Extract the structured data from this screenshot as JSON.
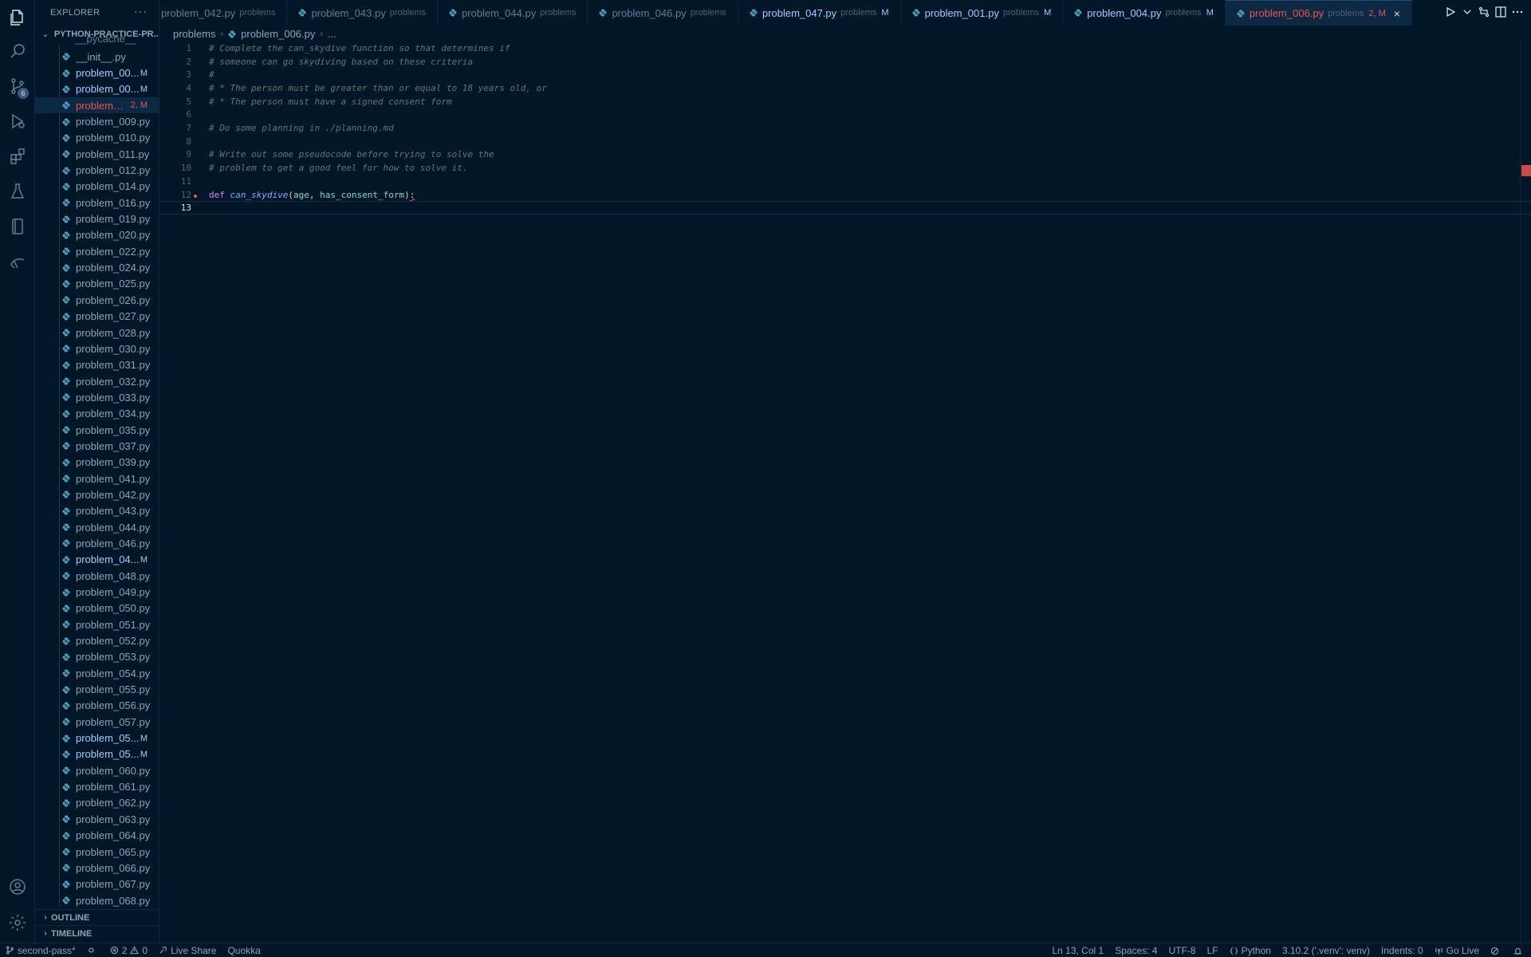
{
  "explorer": {
    "title": "EXPLORER",
    "more": "···",
    "folder": "PYTHON-PRACTICE-PR...",
    "partial_above": "__pycache__",
    "files": [
      {
        "label": "__init__.py",
        "badge": "",
        "state": "normal"
      },
      {
        "label": "problem_00...",
        "badge": "M",
        "state": "mod"
      },
      {
        "label": "problem_00...",
        "badge": "M",
        "state": "mod"
      },
      {
        "label": "problem_...",
        "badge": "2, M",
        "state": "err"
      },
      {
        "label": "problem_009.py",
        "badge": "",
        "state": "normal"
      },
      {
        "label": "problem_010.py",
        "badge": "",
        "state": "normal"
      },
      {
        "label": "problem_011.py",
        "badge": "",
        "state": "normal"
      },
      {
        "label": "problem_012.py",
        "badge": "",
        "state": "normal"
      },
      {
        "label": "problem_014.py",
        "badge": "",
        "state": "normal"
      },
      {
        "label": "problem_016.py",
        "badge": "",
        "state": "normal"
      },
      {
        "label": "problem_019.py",
        "badge": "",
        "state": "normal"
      },
      {
        "label": "problem_020.py",
        "badge": "",
        "state": "normal"
      },
      {
        "label": "problem_022.py",
        "badge": "",
        "state": "normal"
      },
      {
        "label": "problem_024.py",
        "badge": "",
        "state": "normal"
      },
      {
        "label": "problem_025.py",
        "badge": "",
        "state": "normal"
      },
      {
        "label": "problem_026.py",
        "badge": "",
        "state": "normal"
      },
      {
        "label": "problem_027.py",
        "badge": "",
        "state": "normal"
      },
      {
        "label": "problem_028.py",
        "badge": "",
        "state": "normal"
      },
      {
        "label": "problem_030.py",
        "badge": "",
        "state": "normal"
      },
      {
        "label": "problem_031.py",
        "badge": "",
        "state": "normal"
      },
      {
        "label": "problem_032.py",
        "badge": "",
        "state": "normal"
      },
      {
        "label": "problem_033.py",
        "badge": "",
        "state": "normal"
      },
      {
        "label": "problem_034.py",
        "badge": "",
        "state": "normal"
      },
      {
        "label": "problem_035.py",
        "badge": "",
        "state": "normal"
      },
      {
        "label": "problem_037.py",
        "badge": "",
        "state": "normal"
      },
      {
        "label": "problem_039.py",
        "badge": "",
        "state": "normal"
      },
      {
        "label": "problem_041.py",
        "badge": "",
        "state": "normal"
      },
      {
        "label": "problem_042.py",
        "badge": "",
        "state": "normal"
      },
      {
        "label": "problem_043.py",
        "badge": "",
        "state": "normal"
      },
      {
        "label": "problem_044.py",
        "badge": "",
        "state": "normal"
      },
      {
        "label": "problem_046.py",
        "badge": "",
        "state": "normal"
      },
      {
        "label": "problem_04...",
        "badge": "M",
        "state": "mod"
      },
      {
        "label": "problem_048.py",
        "badge": "",
        "state": "normal"
      },
      {
        "label": "problem_049.py",
        "badge": "",
        "state": "normal"
      },
      {
        "label": "problem_050.py",
        "badge": "",
        "state": "normal"
      },
      {
        "label": "problem_051.py",
        "badge": "",
        "state": "normal"
      },
      {
        "label": "problem_052.py",
        "badge": "",
        "state": "normal"
      },
      {
        "label": "problem_053.py",
        "badge": "",
        "state": "normal"
      },
      {
        "label": "problem_054.py",
        "badge": "",
        "state": "normal"
      },
      {
        "label": "problem_055.py",
        "badge": "",
        "state": "normal"
      },
      {
        "label": "problem_056.py",
        "badge": "",
        "state": "normal"
      },
      {
        "label": "problem_057.py",
        "badge": "",
        "state": "normal"
      },
      {
        "label": "problem_05...",
        "badge": "M",
        "state": "mod"
      },
      {
        "label": "problem_05...",
        "badge": "M",
        "state": "mod"
      },
      {
        "label": "problem_060.py",
        "badge": "",
        "state": "normal"
      },
      {
        "label": "problem_061.py",
        "badge": "",
        "state": "normal"
      },
      {
        "label": "problem_062.py",
        "badge": "",
        "state": "normal"
      },
      {
        "label": "problem_063.py",
        "badge": "",
        "state": "normal"
      },
      {
        "label": "problem_064.py",
        "badge": "",
        "state": "normal"
      },
      {
        "label": "problem_065.py",
        "badge": "",
        "state": "normal"
      },
      {
        "label": "problem_066.py",
        "badge": "",
        "state": "normal"
      },
      {
        "label": "problem_067.py",
        "badge": "",
        "state": "normal"
      },
      {
        "label": "problem_068.py",
        "badge": "",
        "state": "normal"
      }
    ],
    "sections": {
      "outline": "OUTLINE",
      "timeline": "TIMELINE"
    }
  },
  "activity": {
    "icons": [
      "files-icon",
      "search-icon",
      "source-control-icon",
      "run-debug-icon",
      "extensions-icon",
      "testing-icon",
      "notebook-icon",
      "remote-explorer-icon",
      "account-icon",
      "settings-gear-icon"
    ],
    "scm_badge": "6"
  },
  "tabs": [
    {
      "name": "problem_042.py",
      "dir": "problems",
      "mod": "",
      "state": "normal"
    },
    {
      "name": "problem_043.py",
      "dir": "problems",
      "mod": "",
      "state": "normal"
    },
    {
      "name": "problem_044.py",
      "dir": "problems",
      "mod": "",
      "state": "normal"
    },
    {
      "name": "problem_046.py",
      "dir": "problems",
      "mod": "",
      "state": "normal"
    },
    {
      "name": "problem_047.py",
      "dir": "problems",
      "mod": "M",
      "state": "modified"
    },
    {
      "name": "problem_001.py",
      "dir": "problems",
      "mod": "M",
      "state": "modified"
    },
    {
      "name": "problem_004.py",
      "dir": "problems",
      "mod": "M",
      "state": "modified"
    },
    {
      "name": "problem_006.py",
      "dir": "problems",
      "mod": "2, M",
      "state": "active",
      "close": "×"
    }
  ],
  "breadcrumb": {
    "folder": "problems",
    "file": "problem_006.py",
    "symbol": "..."
  },
  "editor": {
    "lines": [
      {
        "n": "1",
        "text": "# Complete the can_skydive function so that determines if"
      },
      {
        "n": "2",
        "text": "# someone can go skydiving based on these criteria"
      },
      {
        "n": "3",
        "text": "#"
      },
      {
        "n": "4",
        "text": "# * The person must be greater than or equal to 18 years old, or"
      },
      {
        "n": "5",
        "text": "# * The person must have a signed consent form"
      },
      {
        "n": "6",
        "text": ""
      },
      {
        "n": "7",
        "text": "# Do some planning in ./planning.md"
      },
      {
        "n": "8",
        "text": ""
      },
      {
        "n": "9",
        "text": "# Write out some pseudocode before trying to solve the"
      },
      {
        "n": "10",
        "text": "# problem to get a good feel for how to solve it."
      },
      {
        "n": "11",
        "text": ""
      }
    ],
    "def_line": {
      "n": "12",
      "kw": "def",
      "fn": "can_skydive",
      "open": "(",
      "p1": "age",
      "comma": ", ",
      "p2": "has_consent_form",
      "close": ")",
      "colon": ":"
    },
    "current_line": {
      "n": "13"
    }
  },
  "status": {
    "branch": "second-pass*",
    "errors": "2",
    "warnings": "0",
    "live_share": "Live Share",
    "quokka": "Quokka",
    "position": "Ln 13, Col 1",
    "spaces": "Spaces: 4",
    "encoding": "UTF-8",
    "eol": "LF",
    "language": "Python",
    "interpreter": "3.10.2 ('.venv': venv)",
    "indents": "Indents: 0",
    "go_live": "Go Live"
  },
  "colors": {
    "accent_error": "#ef5350",
    "modified": "#a1cdff",
    "background": "#011627"
  }
}
